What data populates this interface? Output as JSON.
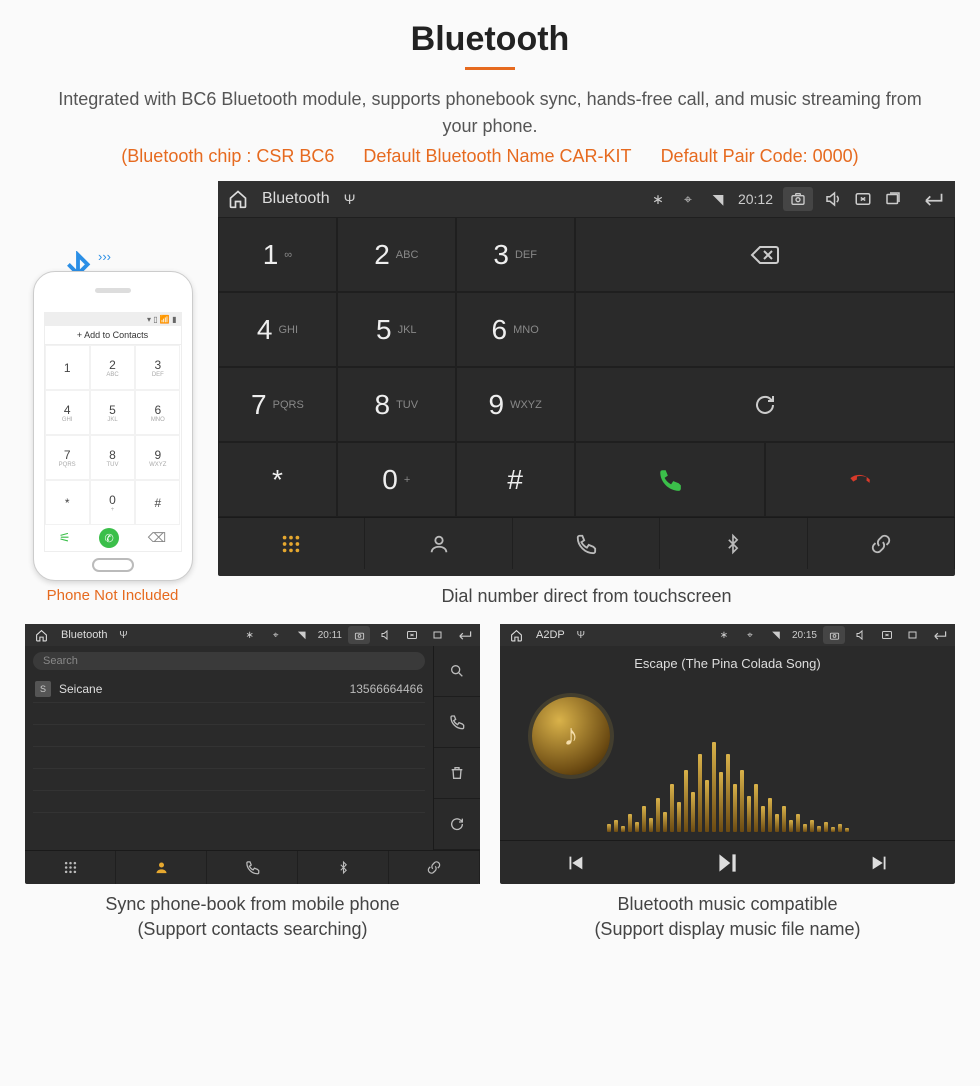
{
  "title": "Bluetooth",
  "subtitle": "Integrated with BC6 Bluetooth module, supports phonebook sync, hands-free call, and music streaming from your phone.",
  "specs": {
    "chip": "(Bluetooth chip : CSR BC6",
    "name": "Default Bluetooth Name CAR-KIT",
    "code": "Default Pair Code: 0000)"
  },
  "phone": {
    "add_label": "+  Add to Contacts",
    "keys": [
      {
        "n": "1",
        "l": ""
      },
      {
        "n": "2",
        "l": "ABC"
      },
      {
        "n": "3",
        "l": "DEF"
      },
      {
        "n": "4",
        "l": "GHI"
      },
      {
        "n": "5",
        "l": "JKL"
      },
      {
        "n": "6",
        "l": "MNO"
      },
      {
        "n": "7",
        "l": "PQRS"
      },
      {
        "n": "8",
        "l": "TUV"
      },
      {
        "n": "9",
        "l": "WXYZ"
      },
      {
        "n": "*",
        "l": ""
      },
      {
        "n": "0",
        "l": "+"
      },
      {
        "n": "#",
        "l": ""
      }
    ],
    "caption": "Phone Not Included"
  },
  "dialer": {
    "statusbar": {
      "title": "Bluetooth",
      "time": "20:12"
    },
    "keys": [
      {
        "n": "1",
        "l": "∞"
      },
      {
        "n": "2",
        "l": "ABC"
      },
      {
        "n": "3",
        "l": "DEF"
      },
      {
        "n": "4",
        "l": "GHI"
      },
      {
        "n": "5",
        "l": "JKL"
      },
      {
        "n": "6",
        "l": "MNO"
      },
      {
        "n": "7",
        "l": "PQRS"
      },
      {
        "n": "8",
        "l": "TUV"
      },
      {
        "n": "9",
        "l": "WXYZ"
      },
      {
        "n": "*",
        "l": ""
      },
      {
        "n": "0",
        "l": "+"
      },
      {
        "n": "#",
        "l": ""
      }
    ],
    "caption": "Dial number direct from touchscreen"
  },
  "contacts": {
    "statusbar": {
      "title": "Bluetooth",
      "time": "20:11"
    },
    "search_placeholder": "Search",
    "rows": [
      {
        "avatar": "S",
        "name": "Seicane",
        "number": "13566664466"
      }
    ],
    "caption": "Sync phone-book from mobile phone",
    "caption2": "(Support contacts searching)"
  },
  "music": {
    "statusbar": {
      "title": "A2DP",
      "time": "20:15"
    },
    "track": "Escape (The Pina Colada Song)",
    "caption": "Bluetooth music compatible",
    "caption2": "(Support display music file name)"
  }
}
